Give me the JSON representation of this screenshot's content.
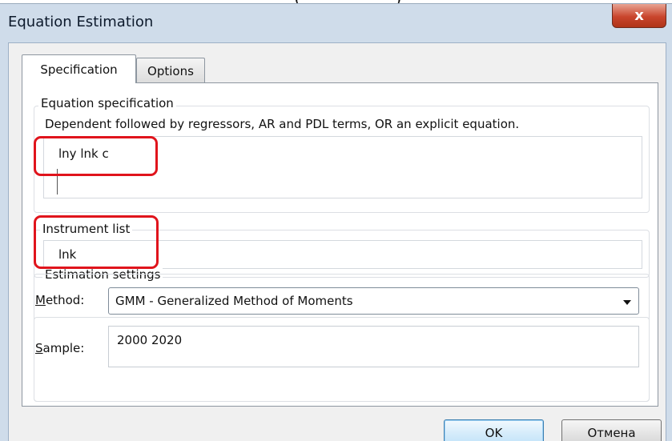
{
  "window": {
    "title": "Equation Estimation",
    "close_label": "x"
  },
  "document": {
    "fragment_text": "()"
  },
  "tabs": [
    {
      "label": "Specification",
      "active": true
    },
    {
      "label": "Options",
      "active": false
    }
  ],
  "equation": {
    "group_label": "Equation specification",
    "hint": "Dependent followed by regressors, AR and PDL terms, OR an explicit equation.",
    "value": "lny lnk c"
  },
  "instruments": {
    "group_label": "Instrument list",
    "value": "lnk"
  },
  "estimation": {
    "group_label": "Estimation settings",
    "method_label_accel": "M",
    "method_label_rest": "ethod:",
    "method_value": "GMM  - Generalized Method of Moments",
    "sample_label_accel": "S",
    "sample_label_rest": "ample:",
    "sample_value": "2000 2020"
  },
  "buttons": {
    "ok_label": "OK",
    "cancel_label": "Отмена"
  },
  "colors": {
    "highlight": "#e0141c",
    "window_frame": "#cfdcea",
    "close_button": "#c9452d"
  }
}
